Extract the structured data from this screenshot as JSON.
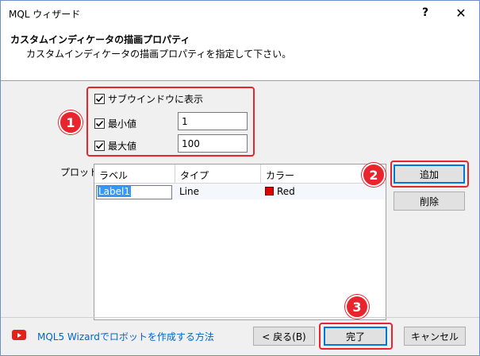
{
  "window": {
    "title": "MQL ウィザード",
    "help_glyph": "?",
    "close_glyph": "✕"
  },
  "header": {
    "title": "カスタムインディケータの描画プロパティ",
    "subtitle": "カスタムインディケータの描画プロパティを指定して下さい。"
  },
  "options": {
    "subwindow_label": "サブウインドウに表示",
    "min_label": "最小値",
    "min_value": "1",
    "max_label": "最大値",
    "max_value": "100"
  },
  "plots": {
    "label": "プロット:",
    "columns": [
      "ラベル",
      "タイプ",
      "カラー"
    ],
    "rows": [
      {
        "label": "Label1",
        "type": "Line",
        "color_name": "Red",
        "color": "#e00000"
      }
    ]
  },
  "buttons": {
    "add": "追加",
    "delete": "削除",
    "back": "< 戻る(B)",
    "finish": "完了",
    "cancel": "キャンセル"
  },
  "footer": {
    "link": "MQL5 Wizardでロボットを作成する方法"
  },
  "callouts": [
    "1",
    "2",
    "3"
  ],
  "colors": {
    "callout": "#e8242d",
    "link": "#0066cc",
    "accent": "#0078d7"
  }
}
